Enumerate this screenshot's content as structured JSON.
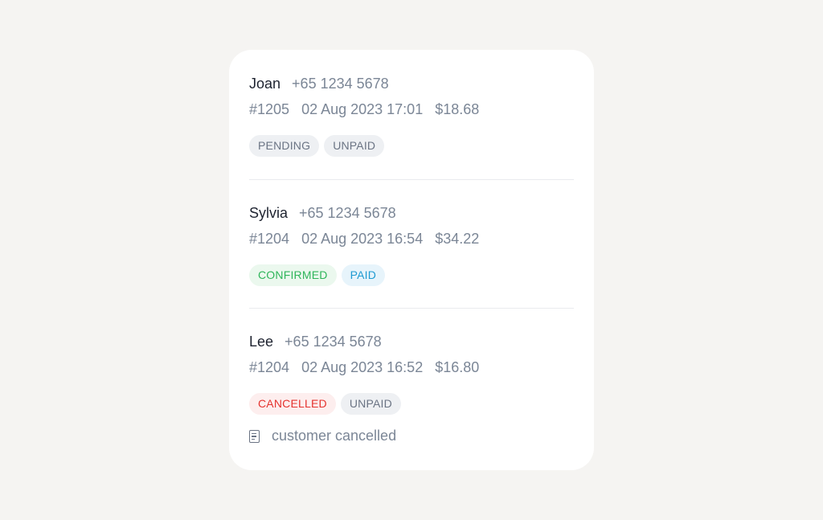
{
  "orders": [
    {
      "name": "Joan",
      "phone": "+65 1234 5678",
      "id": "#1205",
      "datetime": "02 Aug 2023 17:01",
      "amount": "$18.68",
      "status": "PENDING",
      "payment": "UNPAID"
    },
    {
      "name": "Sylvia",
      "phone": "+65 1234 5678",
      "id": "#1204",
      "datetime": "02 Aug 2023 16:54",
      "amount": "$34.22",
      "status": "CONFIRMED",
      "payment": "PAID"
    },
    {
      "name": "Lee",
      "phone": "+65 1234 5678",
      "id": "#1204",
      "datetime": "02 Aug 2023 16:52",
      "amount": "$16.80",
      "status": "CANCELLED",
      "payment": "UNPAID",
      "note": "customer cancelled",
      "note_icon": "document-icon"
    }
  ],
  "colors": {
    "pending": "#6b7484",
    "confirmed": "#2fb55a",
    "paid": "#1f9bd2",
    "cancelled": "#e5332f",
    "unpaid": "#6b7484"
  }
}
